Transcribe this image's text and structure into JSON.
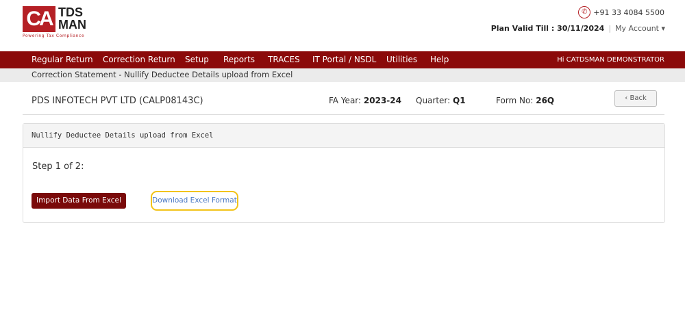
{
  "brand": {
    "logo_mark": "CA",
    "logo_text": "TDS MAN",
    "tagline": "Powering Tax Compliance"
  },
  "header": {
    "phone": "+91 33 4084 5500",
    "plan_label": "Plan Valid Till : 30/11/2024",
    "separator": "|",
    "account": "My Account ▾"
  },
  "nav": {
    "items": [
      "Regular Return",
      "Correction Return",
      "Setup",
      "Reports",
      "TRACES",
      "IT Portal / NSDL",
      "Utilities",
      "Help"
    ],
    "greeting": "Hi CATDSMAN DEMONSTRATOR"
  },
  "breadcrumb": "Correction Statement - Nullify Deductee Details upload from Excel",
  "info": {
    "company": "PDS INFOTECH PVT LTD (CALP08143C)",
    "fa_label": "FA Year:",
    "fa_value": "2023-24",
    "q_label": "Quarter:",
    "q_value": "Q1",
    "form_label": "Form No:",
    "form_value": "26Q",
    "back": "Back"
  },
  "panel": {
    "title": "Nullify Deductee Details upload from Excel",
    "step": "Step 1 of 2:",
    "import": "Import Data From Excel",
    "download": "Download Excel Format"
  }
}
